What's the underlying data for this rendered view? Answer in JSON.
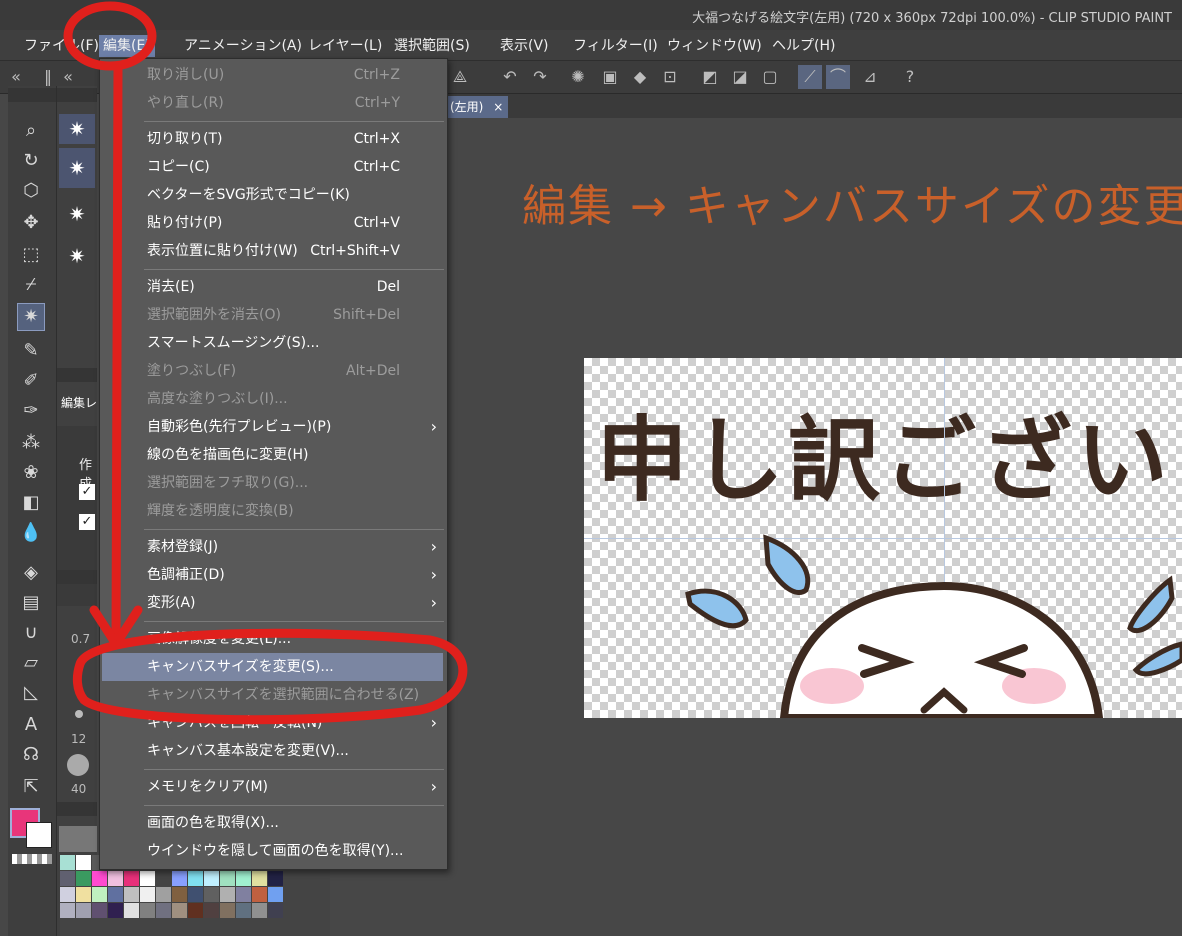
{
  "window": {
    "title": "大福つなげる絵文字(左用) (720 x 360px 72dpi 100.0%)  - CLIP STUDIO PAINT"
  },
  "menubar": [
    {
      "label": "ファイル(F)",
      "name": "menu-file"
    },
    {
      "label": "編集(E)",
      "name": "menu-edit"
    },
    {
      "label": "アニメーション(A)",
      "name": "menu-animation"
    },
    {
      "label": "レイヤー(L)",
      "name": "menu-layer"
    },
    {
      "label": "選択範囲(S)",
      "name": "menu-selection"
    },
    {
      "label": "表示(V)",
      "name": "menu-view"
    },
    {
      "label": "フィルター(I)",
      "name": "menu-filter"
    },
    {
      "label": "ウィンドウ(W)",
      "name": "menu-window"
    },
    {
      "label": "ヘルプ(H)",
      "name": "menu-help"
    }
  ],
  "document_tab": {
    "label": "(左用)"
  },
  "edit_menu": {
    "items": [
      {
        "label": "取り消し(U)",
        "shortcut": "Ctrl+Z",
        "disabled": true
      },
      {
        "label": "やり直し(R)",
        "shortcut": "Ctrl+Y",
        "disabled": true
      },
      {
        "label": "切り取り(T)",
        "shortcut": "Ctrl+X"
      },
      {
        "label": "コピー(C)",
        "shortcut": "Ctrl+C"
      },
      {
        "label": "ベクターをSVG形式でコピー(K)",
        "shortcut": ""
      },
      {
        "label": "貼り付け(P)",
        "shortcut": "Ctrl+V"
      },
      {
        "label": "表示位置に貼り付け(W)",
        "shortcut": "Ctrl+Shift+V"
      },
      {
        "label": "消去(E)",
        "shortcut": "Del"
      },
      {
        "label": "選択範囲外を消去(O)",
        "shortcut": "Shift+Del",
        "disabled": true
      },
      {
        "label": "スマートスムージング(S)...",
        "shortcut": ""
      },
      {
        "label": "塗りつぶし(F)",
        "shortcut": "Alt+Del",
        "disabled": true
      },
      {
        "label": "高度な塗りつぶし(I)...",
        "shortcut": "",
        "disabled": true
      },
      {
        "label": "自動彩色(先行プレビュー)(P)",
        "shortcut": "",
        "submenu": true
      },
      {
        "label": "線の色を描画色に変更(H)",
        "shortcut": ""
      },
      {
        "label": "選択範囲をフチ取り(G)...",
        "shortcut": "",
        "disabled": true
      },
      {
        "label": "輝度を透明度に変換(B)",
        "shortcut": "",
        "disabled": true
      },
      {
        "label": "素材登録(J)",
        "shortcut": "",
        "submenu": true
      },
      {
        "label": "色調補正(D)",
        "shortcut": "",
        "submenu": true
      },
      {
        "label": "変形(A)",
        "shortcut": "",
        "submenu": true
      },
      {
        "label": "画像解像度を変更(L)...",
        "shortcut": ""
      },
      {
        "label": "キャンバスサイズを変更(S)...",
        "shortcut": "",
        "highlighted": true
      },
      {
        "label": "キャンバスサイズを選択範囲に合わせる(Z)",
        "shortcut": "",
        "disabled": true
      },
      {
        "label": "キャンバスを回転・反転(N)",
        "shortcut": "",
        "submenu": true
      },
      {
        "label": "キャンバス基本設定を変更(V)...",
        "shortcut": ""
      },
      {
        "label": "メモリをクリア(M)",
        "shortcut": "",
        "submenu": true
      },
      {
        "label": "画面の色を取得(X)...",
        "shortcut": ""
      },
      {
        "label": "ウインドウを隠して画面の色を取得(Y)...",
        "shortcut": ""
      }
    ]
  },
  "annotation": {
    "text": "編集 → キャンバスサイズの変更",
    "color": "#c8602a"
  },
  "canvas": {
    "text": "申し訳ございませ"
  },
  "left_panel": {
    "tab_label": "編集レ",
    "section_label": "作成",
    "values": [
      "0.7",
      "12",
      "40"
    ]
  },
  "colors": {
    "menu_bg": "#595959",
    "highlight": "#7b86a2",
    "accent_red": "#e0201c",
    "main_color": "#e8357a"
  }
}
